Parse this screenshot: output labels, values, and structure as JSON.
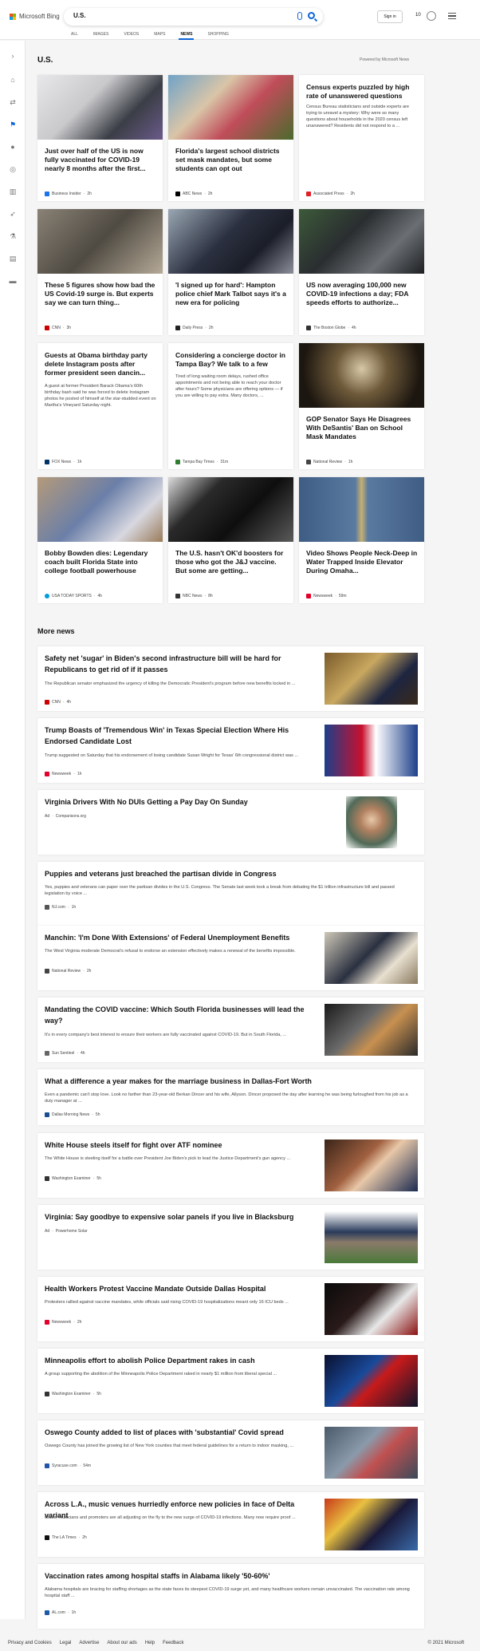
{
  "app": {
    "brand": "Microsoft Bing"
  },
  "search": {
    "query": "U.S."
  },
  "tabs": [
    "ALL",
    "IMAGES",
    "VIDEOS",
    "MAPS",
    "NEWS",
    "SHOPPING"
  ],
  "active_tab": "NEWS",
  "header": {
    "signin": "Sign in",
    "points": "10"
  },
  "section": {
    "title": "U.S.",
    "powered": "Powered by Microsoft News"
  },
  "cards": [
    {
      "title": "Just over half of the US is now fully vaccinated for COVID-19 nearly 8 months after the first...",
      "desc": "",
      "source": "Business Insider",
      "time": "2h",
      "color": "#1a73e8"
    },
    {
      "title": "Florida's largest school districts set mask mandates, but some students can opt out",
      "desc": "",
      "source": "ABC News",
      "time": "2h",
      "color": "#000000"
    },
    {
      "title": "Census experts puzzled by high rate of unanswered questions",
      "desc": "Census Bureau statisticians and outside experts are trying to unravel a mystery: Why were so many questions about households in the 2020 census left unanswered? Residents did not respond to a ...",
      "source": "Associated Press",
      "time": "2h",
      "color": "#e21f26"
    },
    {
      "title": "These 5 figures show how bad the US Covid-19 surge is. But experts say we can turn thing...",
      "desc": "",
      "source": "CNN",
      "time": "3h",
      "color": "#cc0000"
    },
    {
      "title": "'I signed up for hard': Hampton police chief Mark Talbot says it's a new era for policing",
      "desc": "",
      "source": "Daily Press",
      "time": "2h",
      "color": "#222222"
    },
    {
      "title": "US now averaging 100,000 new COVID-19 infections a day; FDA speeds efforts to authorize...",
      "desc": "",
      "source": "The Boston Globe",
      "time": "4h",
      "color": "#333333"
    },
    {
      "title": "Guests at Obama birthday party delete Instagram posts after former president seen dancin...",
      "desc": "A guest at former President Barack Obama's 60th birthday bash said he was forced to delete Instagram photos he posted of himself at the star-studded event on Martha's Vineyard Saturday night.",
      "source": "FOX News",
      "time": "1h",
      "color": "#003366"
    },
    {
      "title": "Considering a concierge doctor in Tampa Bay? We talk to a few",
      "desc": "Tired of long waiting room delays, rushed office appointments and not being able to reach your doctor after hours? Some physicians are offering options — if you are willing to pay extra. Many doctors, ...",
      "source": "Tampa Bay Times",
      "time": "31m",
      "color": "#2e7d32"
    },
    {
      "title": "GOP Senator Says He Disagrees With DeSantis' Ban on School Mask Mandates",
      "desc": "",
      "source": "National Review",
      "time": "1h",
      "color": "#444444"
    },
    {
      "title": "Bobby Bowden dies: Legendary coach built Florida State into college football powerhouse",
      "desc": "",
      "source": "USA TODAY SPORTS",
      "time": "4h",
      "color": "#009bde"
    },
    {
      "title": "The U.S. hasn't OK'd boosters for those who got the J&J vaccine. But some are getting...",
      "desc": "",
      "source": "NBC News",
      "time": "8h",
      "color": "#333333"
    },
    {
      "title": "Video Shows People Neck-Deep in Water Trapped Inside Elevator During Omaha...",
      "desc": "",
      "source": "Newsweek",
      "time": "59m",
      "color": "#e4002b"
    }
  ],
  "more": {
    "title": "More news"
  },
  "rows": [
    {
      "title": "Safety net 'sugar' in Biden's second infrastructure bill will be hard for Republicans to get rid of if it passes",
      "desc": "The Republican senator emphasized the urgency of killing the Democratic President's program before new benefits locked in ...",
      "source": "CNN",
      "time": "4h",
      "color": "#cc0000",
      "ad": false
    },
    {
      "title": "Trump Boasts of 'Tremendous Win' in Texas Special Election Where His Endorsed Candidate Lost",
      "desc": "Trump suggested on Saturday that his endorsement of losing candidate Susan Wright for Texas' 6th congressional district was ...",
      "source": "Newsweek",
      "time": "1h",
      "color": "#e4002b",
      "ad": false
    },
    {
      "title": "Virginia Drivers With No DUIs Getting a Pay Day On Sunday",
      "desc": "",
      "source": "Comparisons.org",
      "time": "",
      "color": "#999999",
      "ad": true
    },
    {
      "title": "Puppies and veterans just breached the partisan divide in Congress",
      "desc": "Yes, puppies and veterans can paper over the partisan divides in the U.S. Congress. The Senate last week took a break from debating the $1 trillion infrastructure bill and passed legislation by voice ...",
      "source": "NJ.com",
      "time": "1h",
      "color": "#555555",
      "ad": false
    },
    {
      "title": "Manchin: 'I'm Done With Extensions' of Federal Unemployment Benefits",
      "desc": "The West Virginia moderate Democrat's refusal to endorse an extension effectively makes a renewal of the benefits impossible.",
      "source": "National Review",
      "time": "2h",
      "color": "#444444",
      "ad": false
    },
    {
      "title": "Mandating the COVID vaccine: Which South Florida businesses will lead the way?",
      "desc": "It's in every company's best interest to ensure their workers are fully vaccinated against COVID-19. But in South Florida, ...",
      "source": "Sun Sentinel",
      "time": "4h",
      "color": "#666666",
      "ad": false
    },
    {
      "title": "What a difference a year makes for the marriage business in Dallas-Fort Worth",
      "desc": "Even a pandemic can't stop love. Look no farther than 23-year-old Berkan Dincer and his wife, Allyson. Dincer proposed the day after learning he was being furloughed from his job as a duty manager at ...",
      "source": "Dallas Morning News",
      "time": "5h",
      "color": "#1b4f91",
      "ad": false
    },
    {
      "title": "White House steels itself for fight over ATF nominee",
      "desc": "The White House is steeling itself for a battle over President Joe Biden's pick to lead the Justice Department's gun agency ...",
      "source": "Washington Examiner",
      "time": "5h",
      "color": "#333333",
      "ad": false
    },
    {
      "title": "Virginia: Say goodbye to expensive solar panels if you live in Blacksburg",
      "desc": "",
      "source": "Powerhome Solar",
      "time": "",
      "color": "#999999",
      "ad": true
    },
    {
      "title": "Health Workers Protest Vaccine Mandate Outside Dallas Hospital",
      "desc": "Protesters rallied against vaccine mandates, while officials said rising COVID-19 hospitalizations meant only 16 ICU beds ...",
      "source": "Newsweek",
      "time": "2h",
      "color": "#e4002b",
      "ad": false
    },
    {
      "title": "Minneapolis effort to abolish Police Department rakes in cash",
      "desc": "A group supporting the abolition of the Minneapolis Police Department raked in nearly $1 million from liberal special ...",
      "source": "Washington Examiner",
      "time": "5h",
      "color": "#333333",
      "ad": false
    },
    {
      "title": "Oswego County added to list of places with 'substantial' Covid spread",
      "desc": "Oswego County has joined the growing list of New York counties that meet federal guidelines for a return to indoor masking, ...",
      "source": "Syracuse.com",
      "time": "54m",
      "color": "#2255aa",
      "ad": false
    },
    {
      "title": "Across L.A., music venues hurriedly enforce new policies in face of Delta variant",
      "desc": "Clubs, musicians and promoters are all adjusting on the fly to the new surge of COVID-19 infections. Many now require proof ...",
      "source": "The LA Times",
      "time": "2h",
      "color": "#111111",
      "ad": false
    },
    {
      "title": "Vaccination rates among hospital staffs in Alabama likely '50-60%'",
      "desc": "Alabama hospitals are bracing for staffing shortages as the state faces its steepest COVID-19 surge yet, and many healthcare workers remain unvaccinated. The vaccination rate among hospital staff ...",
      "source": "AL.com",
      "time": "1h",
      "color": "#1e5aa8",
      "ad": false
    }
  ],
  "ad_label": "Ad",
  "footer": {
    "links": [
      "Privacy and Cookies",
      "Legal",
      "Advertise",
      "About our ads",
      "Help",
      "Feedback"
    ],
    "copyright": "© 2021 Microsoft"
  }
}
